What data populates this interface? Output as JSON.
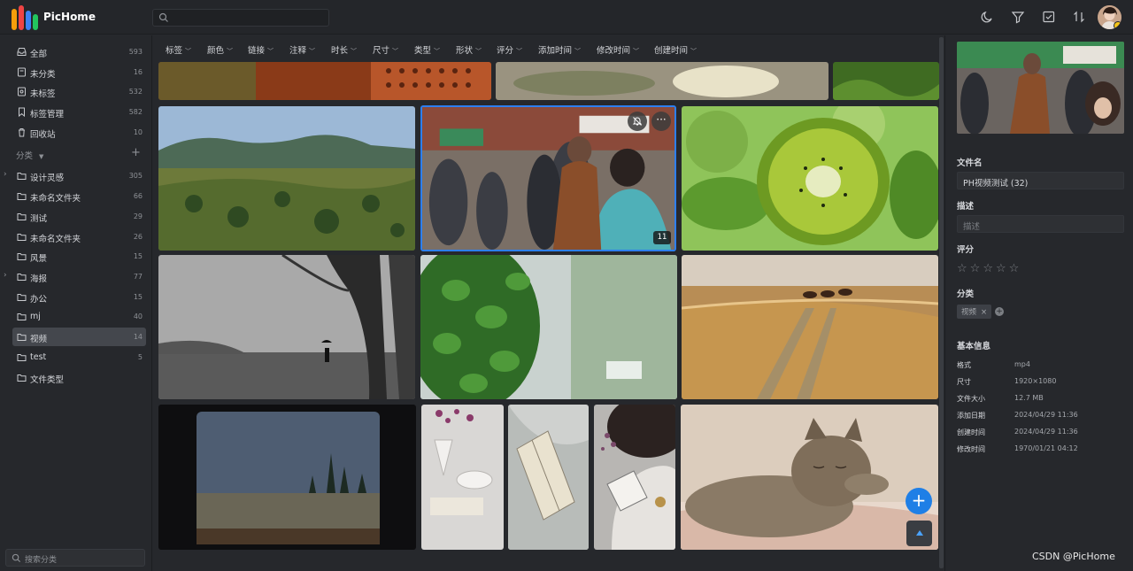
{
  "app": {
    "name": "PicHome"
  },
  "header": {
    "search_placeholder": ""
  },
  "sidebar": {
    "top_items": [
      {
        "label": "全部",
        "count": "593",
        "icon": "inbox-icon"
      },
      {
        "label": "未分类",
        "count": "16",
        "icon": "unclassified-icon"
      },
      {
        "label": "未标签",
        "count": "532",
        "icon": "untagged-icon"
      },
      {
        "label": "标签管理",
        "count": "582",
        "icon": "bookmark-icon"
      },
      {
        "label": "回收站",
        "count": "10",
        "icon": "trash-icon"
      }
    ],
    "section_title": "分类",
    "folders": [
      {
        "label": "设计灵感",
        "count": "305",
        "expandable": true
      },
      {
        "label": "未命名文件夹",
        "count": "66",
        "expandable": false
      },
      {
        "label": "测试",
        "count": "29",
        "expandable": false
      },
      {
        "label": "未命名文件夹",
        "count": "26",
        "expandable": false
      },
      {
        "label": "风景",
        "count": "15",
        "expandable": false
      },
      {
        "label": "海报",
        "count": "77",
        "expandable": true
      },
      {
        "label": "办公",
        "count": "15",
        "expandable": false
      },
      {
        "label": "mj",
        "count": "40",
        "expandable": false
      },
      {
        "label": "视频",
        "count": "14",
        "expandable": false,
        "active": true
      },
      {
        "label": "test",
        "count": "5",
        "expandable": false
      },
      {
        "label": "文件类型",
        "count": "",
        "expandable": false
      }
    ],
    "search_placeholder": "搜索分类"
  },
  "filters": [
    "标签",
    "颜色",
    "链接",
    "注释",
    "时长",
    "尺寸",
    "类型",
    "形状",
    "评分",
    "添加时间",
    "修改时间",
    "创建时间"
  ],
  "grid": {
    "selected_badge": "11"
  },
  "details": {
    "filename_label": "文件名",
    "filename": "PH视频测试 (32)",
    "desc_label": "描述",
    "desc_placeholder": "描述",
    "rating_label": "评分",
    "rating": 0,
    "category_label": "分类",
    "category_tag": "视频",
    "basic_info_label": "基本信息",
    "info": [
      {
        "k": "格式",
        "v": "mp4"
      },
      {
        "k": "尺寸",
        "v": "1920×1080"
      },
      {
        "k": "文件大小",
        "v": "12.7 MB"
      },
      {
        "k": "添加日期",
        "v": "2024/04/29 11:36"
      },
      {
        "k": "创建时间",
        "v": "2024/04/29 11:36"
      },
      {
        "k": "修改时间",
        "v": "1970/01/21 04:12"
      }
    ]
  },
  "watermark": "CSDN @PicHome",
  "fab": {
    "add_label": "+"
  }
}
